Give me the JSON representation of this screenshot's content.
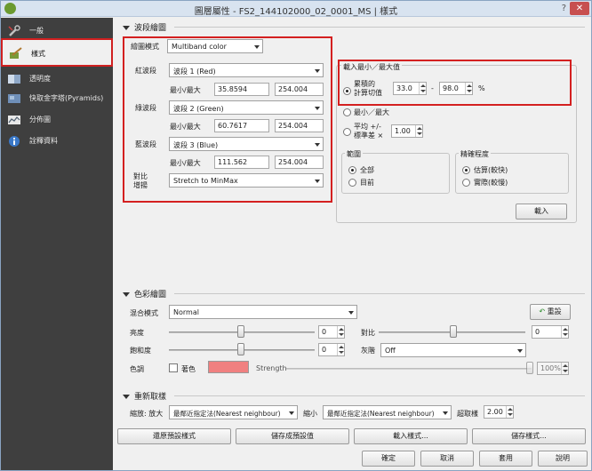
{
  "window": {
    "title": "圖層屬性 - FS2_144102000_02_0001_MS | 樣式",
    "help": "?",
    "close": "✕"
  },
  "sidebar": {
    "items": [
      {
        "label": "一般",
        "icon": "wrench-icon"
      },
      {
        "label": "樣式",
        "icon": "paintbrush-icon"
      },
      {
        "label": "透明度",
        "icon": "transparency-icon"
      },
      {
        "label": "快取金字塔(Pyramids)",
        "icon": "pyramid-icon"
      },
      {
        "label": "分佈圖",
        "icon": "histogram-icon"
      },
      {
        "label": "詮釋資料",
        "icon": "info-icon"
      }
    ]
  },
  "band_render": {
    "section_title": "波段繪圖",
    "render_type_label": "繪圖模式",
    "render_type_value": "Multiband color",
    "red_label": "紅波段",
    "red_band": "波段 1 (Red)",
    "red_minmax_label": "最小/最大",
    "red_min": "35.8594",
    "red_max": "254.004",
    "green_label": "綠波段",
    "green_band": "波段 2 (Green)",
    "green_minmax_label": "最小/最大",
    "green_min": "60.7617",
    "green_max": "254.004",
    "blue_label": "藍波段",
    "blue_band": "波段 3 (Blue)",
    "blue_minmax_label": "最小/最大",
    "blue_min": "111.562",
    "blue_max": "254.004",
    "contrast_label_1": "對比",
    "contrast_label_2": "增揚",
    "contrast_value": "Stretch to MinMax"
  },
  "load_minmax": {
    "title": "載入最小／最大值",
    "cumulative_label_1": "累積的",
    "cumulative_label_2": "計算切值",
    "cum_from": "33.0",
    "dash": "-",
    "cum_to": "98.0",
    "percent": "%",
    "minmax_label": "最小／最大",
    "stddev_label_1": "平均 +/-",
    "stddev_label_2": "標準差 ×",
    "stddev_value": "1.00",
    "extent_title": "範圍",
    "extent_full": "全部",
    "extent_current": "目前",
    "accuracy_title": "精確程度",
    "accuracy_estimate": "估算(較快)",
    "accuracy_actual": "實際(較慢)",
    "load_button": "載入"
  },
  "color_render": {
    "section_title": "色彩繪圖",
    "blend_label": "混合模式",
    "blend_value": "Normal",
    "reset_button": "重設",
    "brightness_label": "亮度",
    "brightness_value": "0",
    "contrast_label": "對比",
    "contrast_value": "0",
    "saturation_label": "飽和度",
    "saturation_value": "0",
    "grayscale_label": "灰階",
    "grayscale_value": "Off",
    "hue_label": "色調",
    "colorize_label": "著色",
    "colorize_color": "#f08080",
    "strength_label": "Strength",
    "strength_value": "100%"
  },
  "resampling": {
    "section_title": "重新取樣",
    "zoomin_label": "縮放: 放大",
    "zoomin_value": "最鄰近指定法(Nearest neighbour)",
    "zoomout_label": "縮小",
    "zoomout_value": "最鄰近指定法(Nearest neighbour)",
    "oversampling_label": "超取樣",
    "oversampling_value": "2.00"
  },
  "style_buttons": {
    "restore_default": "還原預設樣式",
    "save_default": "儲存成預設值",
    "load_style": "載入樣式...",
    "save_style": "儲存樣式..."
  },
  "dialog_buttons": {
    "ok": "確定",
    "cancel": "取消",
    "apply": "套用",
    "help": "說明"
  }
}
